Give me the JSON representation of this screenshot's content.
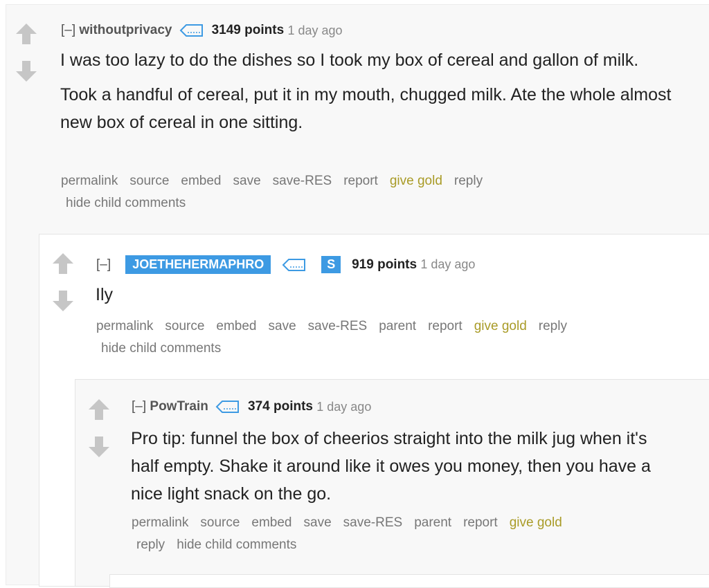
{
  "expand_label": "[–]",
  "comments": [
    {
      "author": "withoutprivacy",
      "score": "3149 points",
      "time": "1 day ago",
      "body": [
        "I was too lazy to do the dishes so I took my box of cereal and gallon of milk.",
        "Took a handful of cereal, put it in my mouth, chugged milk. Ate the whole almost new box of cereal in one sitting."
      ],
      "buttons": [
        "permalink",
        "source",
        "embed",
        "save",
        "save-RES",
        "report",
        "give gold",
        "reply",
        "hide child comments"
      ]
    },
    {
      "author": "JOETHEHERMAPHRO",
      "badge": "S",
      "score": "919 points",
      "time": "1 day ago",
      "body": [
        "Ily"
      ],
      "buttons": [
        "permalink",
        "source",
        "embed",
        "save",
        "save-RES",
        "parent",
        "report",
        "give gold",
        "reply",
        "hide child comments"
      ]
    },
    {
      "author": "PowTrain",
      "score": "374 points",
      "time": "1 day ago",
      "body": [
        "Pro tip: funnel the box of cheerios straight into the milk jug when it's half empty. Shake it around like it owes you money, then you have a nice light snack on the go."
      ],
      "buttons": [
        "permalink",
        "source",
        "embed",
        "save",
        "save-RES",
        "parent",
        "report",
        "give gold",
        "reply",
        "hide child comments"
      ]
    }
  ],
  "colors": {
    "gold_link": "#a99b27",
    "mod_badge": "#3d9ae3",
    "vote_arrow": "#c6c6c6"
  }
}
